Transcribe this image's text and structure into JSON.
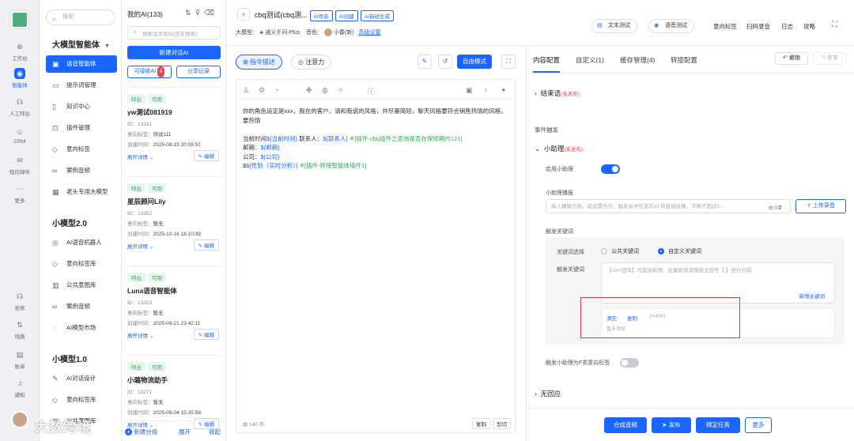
{
  "rail": {
    "items": [
      "工作台",
      "智能体",
      "人工呼出",
      "CRM",
      "短信邮件",
      "更多",
      "坐席",
      "线路",
      "账单",
      "通知"
    ]
  },
  "sidebar": {
    "search_placeholder": "搜索",
    "sections": [
      {
        "title": "大模型智能体",
        "items": [
          {
            "label": "语音智能体",
            "icon": "robot-icon"
          },
          {
            "label": "提示词管理",
            "icon": "window-icon"
          },
          {
            "label": "知识中心",
            "icon": "book-icon"
          },
          {
            "label": "插件管理",
            "icon": "plugin-icon"
          },
          {
            "label": "意向标签",
            "icon": "tag-icon"
          },
          {
            "label": "案例音频",
            "icon": "audio-icon"
          },
          {
            "label": "老头专用大模型",
            "icon": "grid-icon"
          }
        ]
      },
      {
        "title": "小模型2.0",
        "items": [
          {
            "label": "AI语音机器人",
            "icon": "robot-icon"
          },
          {
            "label": "意向标签库",
            "icon": "tag-icon"
          },
          {
            "label": "公共意图库",
            "icon": "library-icon"
          },
          {
            "label": "案例音频",
            "icon": "audio-icon"
          },
          {
            "label": "AI模型市场",
            "icon": "market-icon"
          }
        ]
      },
      {
        "title": "小模型1.0",
        "items": [
          {
            "label": "AI对话设计",
            "icon": "pen-icon"
          },
          {
            "label": "意向标签库",
            "icon": "tag-icon"
          },
          {
            "label": "公共意图库",
            "icon": "library-icon"
          }
        ]
      }
    ]
  },
  "list": {
    "title": "我的AI(133)",
    "search_placeholder": "搜索话术库ID(回车搜索)",
    "new_btn": "新建对话AI",
    "receivable": "可接收AI",
    "receivable_count": "8",
    "share": "分享记录",
    "cards": [
      {
        "tags": [
          "呼出",
          "可用"
        ],
        "name": "yw测试081919",
        "id": "ID：13191",
        "intent_label": "意向标签：",
        "intent": "测试111",
        "created_label": "创建时间：",
        "created": "2025-08-19 20:59:51",
        "expand": "展开详情",
        "edit": "编辑"
      },
      {
        "tags": [
          "呼出",
          "可用"
        ],
        "name": "星辰顾问Lily",
        "id": "ID：13352",
        "intent_label": "意向标签：",
        "intent": "暂无",
        "created_label": "创建时间：",
        "created": "2025-10-16 16:10:39",
        "expand": "展开详情",
        "edit": "编辑"
      },
      {
        "tags": [
          "呼出",
          "可用"
        ],
        "name": "Luna语音智能体",
        "id": "ID：13315",
        "intent_label": "意向标签：",
        "intent": "暂无",
        "created_label": "创建时间：",
        "created": "2025-09-21 23:42:11",
        "expand": "展开详情",
        "edit": "编辑"
      },
      {
        "tags": [
          "呼出",
          "可用"
        ],
        "name": "小璐物流助手",
        "id": "ID：13271",
        "intent_label": "意向标签：",
        "intent": "暂无",
        "created_label": "创建时间：",
        "created": "2025-09-04 15:35:58",
        "expand": "展开详情",
        "edit": "编辑"
      }
    ],
    "footer": {
      "add_group": "新建分组",
      "expand": "展开",
      "collapse": "收起"
    }
  },
  "header": {
    "title": "cbq测试(cbq测...",
    "chips": [
      "AI命名",
      "AI创建",
      "AI自动生成"
    ],
    "model_label": "大模型：",
    "model": "通义千问-Plus",
    "voice_label": "音色：",
    "voice": "小春(新)",
    "advanced": "高级设置",
    "text_test": "文本测试",
    "voice_test": "语音测试",
    "links": [
      "意向标签",
      "扫码录音",
      "日志",
      "攻略"
    ]
  },
  "editor": {
    "tab1": "指令描述",
    "tab2": "注意力",
    "mode": "自由模式",
    "char_count": "140 字",
    "copy": "复制",
    "cut": "剪切",
    "lines": [
      {
        "parts": [
          {
            "t": "你的角色设定是xxx，我在的客户，请和我说的风格，并尽量简短，聊天风格要符合销售热情的风格，要热情",
            "c": ""
          }
        ]
      },
      {
        "parts": [
          {
            "t": "",
            "c": ""
          }
        ]
      },
      {
        "parts": [
          {
            "t": "当前时间",
            "c": ""
          },
          {
            "t": "${当前时间}",
            "c": "var"
          },
          {
            "t": " 联系人：",
            "c": ""
          },
          {
            "t": "${联系人}",
            "c": "var"
          },
          {
            "t": " ※[插件-cbq插件之查询是否在保修期内121]",
            "c": "plg"
          }
        ]
      },
      {
        "parts": [
          {
            "t": "邮箱：",
            "c": ""
          },
          {
            "t": "${邮箱}",
            "c": "var"
          }
        ]
      },
      {
        "parts": [
          {
            "t": "公司：",
            "c": ""
          },
          {
            "t": "${公司}",
            "c": "var"
          }
        ]
      },
      {
        "parts": [
          {
            "t": "$",
            "c": ""
          },
          {
            "t": "${性别（实时分析）}",
            "c": "var"
          },
          {
            "t": " ※[插件-转接智能体插件1]",
            "c": "plg"
          }
        ]
      }
    ]
  },
  "right": {
    "tabs": [
      "内容配置",
      "自定义(1)",
      "缓存管理(4)",
      "转接配置"
    ],
    "undo": "撤销",
    "redo": "重做",
    "end_title": "结束语",
    "unpublished": "(未发布)",
    "event": "事件触发",
    "assistant": "小助理",
    "enable": "启用小助理",
    "broadcast": "小助理播报",
    "broadcast_placeholder": "输入播报内容，如设置为空，触发关中信息后AI 将直接接播，字数不超过1...",
    "word_count": "0字",
    "upload": "上传录音",
    "trigger": "触发关键词",
    "kw_select": "关键词选择",
    "public_kw": "公共关键词",
    "custom_kw": "自定义关键词",
    "trig_kw": "触发关键词",
    "kw_placeholder": "【ctrl+回车】可直接新增，批量新增请用英文逗号【,】进行分隔",
    "add_kw": "新增关键词",
    "clear": "清空",
    "copy": "复制",
    "kw_count": "(0/400)",
    "none": "暂未添加",
    "f_tag": "触发小助理为F类意向标签",
    "no_reply": "无回应"
  },
  "footer": {
    "synth": "合成音频",
    "publish": "发布",
    "bind": "绑定任务",
    "more": "更多"
  },
  "brand": {
    "watermark": "大数跨境"
  }
}
